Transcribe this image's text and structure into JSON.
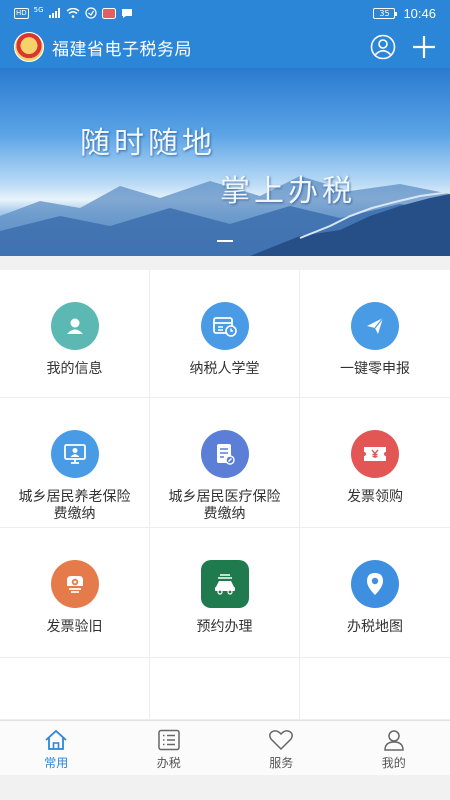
{
  "status_bar": {
    "network_chip": "HD",
    "network_type": "5G",
    "battery": "35",
    "time": "10:46"
  },
  "header": {
    "title": "福建省电子税务局"
  },
  "banner": {
    "slogan_line1": "随时随地",
    "slogan_line2": "掌上办税"
  },
  "services": [
    {
      "label": "我的信息",
      "icon": "user-card-icon",
      "color": "#5cb8b2"
    },
    {
      "label": "纳税人学堂",
      "icon": "calendar-clock-icon",
      "color": "#4a9be6"
    },
    {
      "label": "一键零申报",
      "icon": "paper-plane-icon",
      "color": "#4a9be6"
    },
    {
      "label": "城乡居民养老保险费缴纳",
      "icon": "monitor-person-icon",
      "color": "#4a9be6"
    },
    {
      "label": "城乡居民医疗保险费缴纳",
      "icon": "document-edit-icon",
      "color": "#5b7fd6"
    },
    {
      "label": "发票领购",
      "icon": "ticket-yen-icon",
      "color": "#e25656"
    },
    {
      "label": "发票验旧",
      "icon": "invoice-check-icon",
      "color": "#e57b4a"
    },
    {
      "label": "预约办理",
      "icon": "car-appointment-icon",
      "color": "#1f7a4e"
    },
    {
      "label": "办税地图",
      "icon": "map-pin-icon",
      "color": "#3f8fe0"
    }
  ],
  "tabs": [
    {
      "label": "常用",
      "icon": "home-icon",
      "active": true
    },
    {
      "label": "办税",
      "icon": "list-icon",
      "active": false
    },
    {
      "label": "服务",
      "icon": "heart-icon",
      "active": false
    },
    {
      "label": "我的",
      "icon": "person-icon",
      "active": false
    }
  ],
  "colors": {
    "primary": "#2b86d8"
  }
}
